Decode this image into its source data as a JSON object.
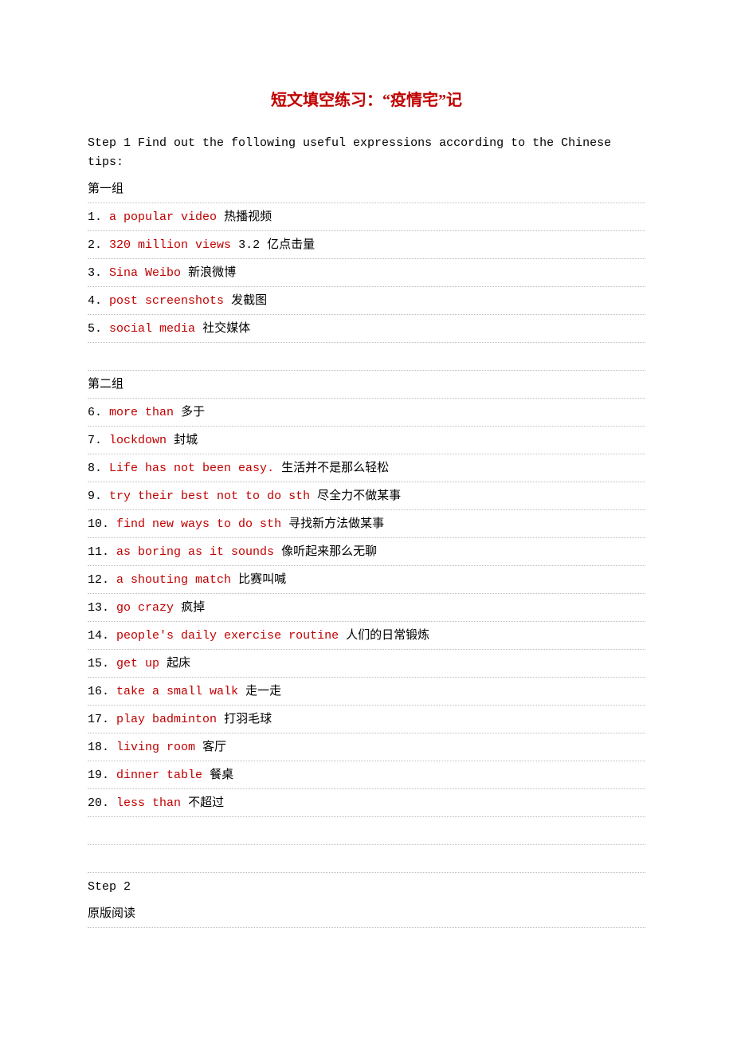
{
  "title": "短文填空练习：“疫情宅”记",
  "step1_label": "Step 1 Find out the following useful expressions according to the Chinese tips:",
  "group1_label": "第一组",
  "group1": [
    {
      "num": "1.",
      "en": "a popular video",
      "zh": " 热播视频"
    },
    {
      "num": "2.",
      "en": "320 million views",
      "zh": " 3.2 亿点击量"
    },
    {
      "num": "3.",
      "en": "Sina Weibo",
      "zh": " 新浪微博"
    },
    {
      "num": "4.",
      "en": "post screenshots",
      "zh": " 发截图"
    },
    {
      "num": "5.",
      "en": "social media",
      "zh": " 社交媒体"
    }
  ],
  "group2_label": "第二组",
  "group2": [
    {
      "num": "6.",
      "en": "more than",
      "zh": " 多于"
    },
    {
      "num": "7.",
      "en": "lockdown",
      "zh": " 封城"
    },
    {
      "num": "8.",
      "en": "Life has not been easy.",
      "zh": " 生活并不是那么轻松"
    },
    {
      "num": "9.",
      "en": "try their best not to do sth",
      "zh": " 尽全力不做某事"
    },
    {
      "num": "10.",
      "en": "find new ways to do sth",
      "zh": " 寻找新方法做某事"
    },
    {
      "num": "11.",
      "en": "as boring as it sounds",
      "zh": " 像听起来那么无聊"
    },
    {
      "num": "12.",
      "en": "a shouting match",
      "zh": " 比赛叫喊"
    },
    {
      "num": "13.",
      "en": "go crazy",
      "zh": " 疯掉"
    },
    {
      "num": "14.",
      "en": "people's daily exercise routine",
      "zh": " 人们的日常锻炼"
    },
    {
      "num": "15.",
      "en": "get up",
      "zh": " 起床"
    },
    {
      "num": "16.",
      "en": "take a small walk",
      "zh": " 走一走"
    },
    {
      "num": "17.",
      "en": "play badminton",
      "zh": " 打羽毛球"
    },
    {
      "num": "18.",
      "en": "living room",
      "zh": " 客厅"
    },
    {
      "num": "19.",
      "en": "dinner table",
      "zh": " 餐桌"
    },
    {
      "num": "20.",
      "en": "less than",
      "zh": " 不超过"
    }
  ],
  "step2_label": "Step 2",
  "step2_sub": "原版阅读"
}
